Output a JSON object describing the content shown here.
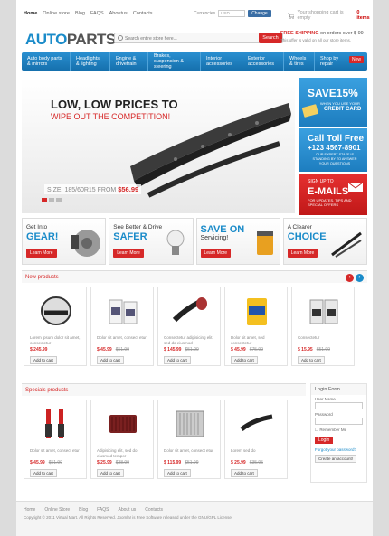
{
  "top": {
    "links": [
      "Home",
      "Online store",
      "Blog",
      "FAQS",
      "Aboutus",
      "Contacts"
    ],
    "currency_label": "Currencies",
    "currency_value": "USD",
    "change": "Change",
    "cart": "Your shopping cart is empty",
    "cart_count": "0 items"
  },
  "logo": {
    "a": "AUTO",
    "b": "PARTS"
  },
  "search": {
    "placeholder": "Search entire store here...",
    "button": "Search"
  },
  "shipping": {
    "label": "FREE SHIPPING",
    "text": "on orders over $ 99",
    "sub": "This offer is valid on all our store items."
  },
  "nav": [
    "Auto body parts & mirrors",
    "Headlights & lighting",
    "Engine & drivetrain",
    "Brakes, suspension & steering",
    "Interior accessories",
    "Exterior accessories",
    "Wheels & tires",
    "Shop by repair"
  ],
  "nav_new": "New",
  "hero": {
    "line1": "LOW, LOW PRICES TO",
    "line2": "WIPE OUT THE COMPETITION!",
    "size": "SIZE: 185/60R15  FROM",
    "price": "$56.99"
  },
  "promo": {
    "save": "SAVE15%",
    "save_sub": "WHEN YOU USE YOUR",
    "save_card": "CREDIT CARD",
    "call": "Call Toll Free",
    "phone": "+123 4567-8901",
    "call_sub": "OUR EXPERT STAFF IS STANDING BY TO ANSWER YOUR QUESTIONS",
    "signup": "SIGN UP TO",
    "emails": "E-MAILS",
    "emails_sub": "FOR UPDATES, TIPS AND SPECIAL OFFERS"
  },
  "cats": [
    {
      "a": "Get Into",
      "b": "GEAR!",
      "btn": "Learn More"
    },
    {
      "a": "See Better & Drive",
      "b": "SAFER",
      "btn": "Learn More"
    },
    {
      "a": "SAVE ON",
      "b": "Servicing!",
      "btn": "Learn More"
    },
    {
      "a": "A Clearer",
      "b": "CHOICE",
      "btn": "Learn More"
    }
  ],
  "new_title": "New products",
  "new_products": [
    {
      "name": "Lorem ipsum dolor sit amet, consectetur",
      "price": "$ 245.99",
      "old": "",
      "btn": "Add to cart"
    },
    {
      "name": "Dolor sit amet, consect etur",
      "price": "$ 45.99",
      "old": "$51.99",
      "btn": "Add to cart"
    },
    {
      "name": "Consectetur adipisicing elit, sed do eiusmod",
      "price": "$ 145.99",
      "old": "$51.99",
      "btn": "Add to cart"
    },
    {
      "name": "Dolor sit amet, sed consectetur",
      "price": "$ 45.99",
      "old": "$75.99",
      "btn": "Add to cart"
    },
    {
      "name": "Consectetur",
      "price": "$ 15.95",
      "old": "$51.99",
      "btn": "Add to cart"
    }
  ],
  "specials_title": "Specials products",
  "special_products": [
    {
      "name": "Dolor sit amet, consect etur",
      "price": "$ 45.99",
      "old": "$51.99",
      "btn": "Add to cart"
    },
    {
      "name": "Adipisicing elit, sed do eiusmod tempor",
      "price": "$ 25.99",
      "old": "$38.99",
      "btn": "Add to cart"
    },
    {
      "name": "Dolor sit amet, consect etur",
      "price": "$ 115.99",
      "old": "$51.99",
      "btn": "Add to cart"
    },
    {
      "name": "Lorem sed do",
      "price": "$ 25.99",
      "old": "$35.95",
      "btn": "Add to cart"
    }
  ],
  "login": {
    "title": "Login Form",
    "user": "User Name",
    "pass": "Password",
    "remember": "Remember Me",
    "button": "Login",
    "forgot": "Forgot your password?",
    "create": "Create an account!"
  },
  "footer": {
    "links": [
      "Home",
      "Online Store",
      "Blog",
      "FAQS",
      "About us",
      "Contacts"
    ],
    "copy": "Copyright © 2011 Virtual Mart. All Rights Reserved. Joomla! is Free Software released under the GNU/GPL License."
  }
}
